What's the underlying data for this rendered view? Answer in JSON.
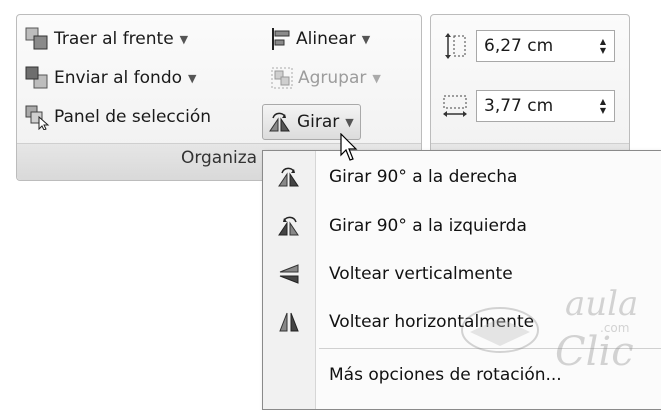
{
  "ribbon": {
    "arrange_group": {
      "label": "Organiza",
      "bring_to_front": "Traer al frente",
      "send_to_back": "Enviar al fondo",
      "selection_pane": "Panel de selección",
      "align": "Alinear",
      "group": "Agrupar",
      "rotate": "Girar"
    },
    "size_group": {
      "height_value": "6,27 cm",
      "width_value": "3,77 cm"
    }
  },
  "rotate_menu": {
    "items": [
      {
        "label": "Girar 90° a la derecha",
        "icon": "rotate-right-icon"
      },
      {
        "label": "Girar 90° a la izquierda",
        "icon": "rotate-left-icon"
      },
      {
        "label": "Voltear verticalmente",
        "icon": "flip-vertical-icon"
      },
      {
        "label": "Voltear horizontalmente",
        "icon": "flip-horizontal-icon"
      },
      {
        "label": "Más opciones de rotación...",
        "icon": ""
      }
    ]
  },
  "watermark": {
    "text_top": "aula",
    "text_bottom": "Clic",
    "text_small": ".com"
  }
}
